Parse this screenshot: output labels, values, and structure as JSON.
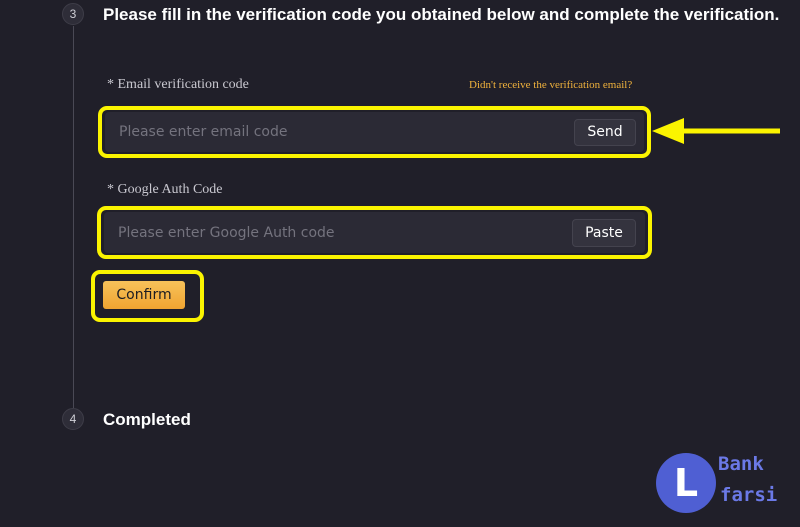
{
  "steps": [
    {
      "number": "3",
      "title": "Please fill in the verification code you obtained below and complete the verification."
    },
    {
      "number": "4",
      "title": "Completed"
    }
  ],
  "email_field": {
    "label": "* Email verification code",
    "resend_link": "Didn't receive the verification email?",
    "placeholder": "Please enter email code",
    "value": "",
    "button_label": "Send"
  },
  "google_field": {
    "label": "* Google Auth Code",
    "placeholder": "Please enter Google Auth code",
    "value": "",
    "button_label": "Paste"
  },
  "confirm_label": "Confirm",
  "watermark": {
    "letter": "L",
    "line1": "Bank",
    "line2": "farsi"
  },
  "colors": {
    "background": "#201f29",
    "highlight": "#fbf400",
    "accent": "#f0b23c",
    "logo": "#4f5fd3"
  }
}
